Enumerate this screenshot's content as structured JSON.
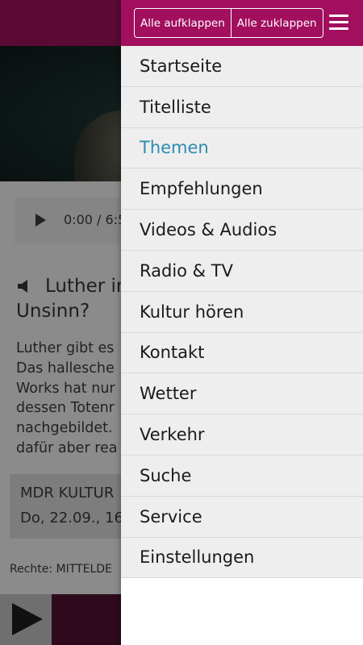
{
  "background": {
    "player": {
      "time": "0:00 / 6:5"
    },
    "article": {
      "title": "Luther in\nUnsinn?",
      "body": "Luther gibt es\nDas hallesche\nWorks hat nur\ndessen Totenr\nnachgebildet.\ndafür aber rea"
    },
    "meta": {
      "line1": "MDR KULTUR",
      "line2": "Do, 22.09., 16"
    },
    "rights": "Rechte: MITTELDE"
  },
  "drawer": {
    "expand_all_label": "Alle aufklappen",
    "collapse_all_label": "Alle zuklappen",
    "items": [
      {
        "label": "Startseite"
      },
      {
        "label": "Titelliste"
      },
      {
        "label": "Themen"
      },
      {
        "label": "Empfehlungen"
      },
      {
        "label": "Videos & Audios"
      },
      {
        "label": "Radio & TV"
      },
      {
        "label": "Kultur hören"
      },
      {
        "label": "Kontakt"
      },
      {
        "label": "Wetter"
      },
      {
        "label": "Verkehr"
      },
      {
        "label": "Suche"
      },
      {
        "label": "Service"
      },
      {
        "label": "Einstellungen"
      }
    ],
    "active_item": "Themen"
  },
  "colors": {
    "header": "#a10f5e",
    "active_item": "#2c8bb0",
    "menu_bg": "#eeeeee"
  },
  "icons": {
    "player_play": "play-icon",
    "speaker": "speaker-icon",
    "menu": "hamburger-menu-icon",
    "bottom_play": "play-icon"
  }
}
